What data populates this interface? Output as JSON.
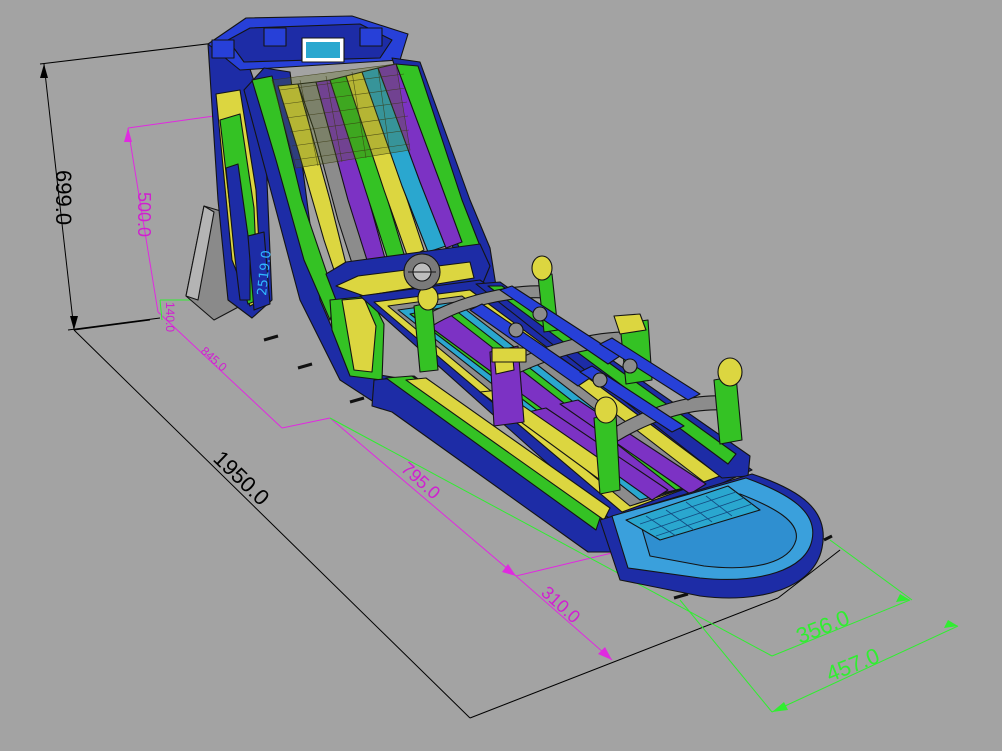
{
  "viewport": {
    "background": "#a3a3a3"
  },
  "model": {
    "name": "inflatable triple-lane water slide",
    "colors": {
      "navy": "#1d2ca6",
      "blue": "#2740d8",
      "green": "#34c224",
      "yellow": "#dcd640",
      "purple": "#7c32c4",
      "cyan": "#2aa7cf",
      "grey": "#8c8c8c",
      "pool_water": "#2f8fd0",
      "pool_rim": "#3aa0dc"
    },
    "tower_sign": "",
    "side_logo": "2519.0"
  },
  "dimensions": {
    "overall_height": "699.0",
    "platform_height": "500.0",
    "small_height": "140.0",
    "slide_length": "845.0",
    "run_length": "795.0",
    "pool_length": "310.0",
    "overall_length": "1950.0",
    "pool_width": "356.0",
    "overall_width": "457.0"
  }
}
